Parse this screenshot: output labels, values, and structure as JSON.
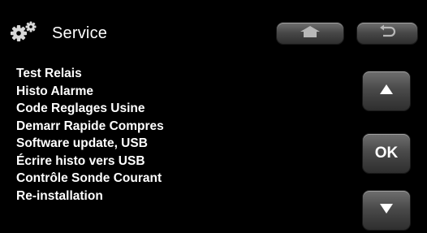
{
  "header": {
    "title": "Service",
    "icon": "gears-icon",
    "buttons": [
      {
        "name": "home-button",
        "icon": "home-icon"
      },
      {
        "name": "back-button",
        "icon": "back-arrow-icon"
      }
    ]
  },
  "menu": {
    "items": [
      {
        "label": "Test Relais"
      },
      {
        "label": "Histo Alarme"
      },
      {
        "label": "Code Reglages Usine"
      },
      {
        "label": "Demarr Rapide Compres"
      },
      {
        "label": "Software update, USB"
      },
      {
        "label": "Écrire histo vers USB"
      },
      {
        "label": "Contrôle Sonde Courant"
      },
      {
        "label": "Re-installation"
      }
    ]
  },
  "nav": {
    "up_icon": "triangle-up-icon",
    "ok_label": "OK",
    "down_icon": "triangle-down-icon"
  },
  "colors": {
    "background": "#000000",
    "text": "#ffffff",
    "button_top": "#6f6f6f",
    "button_bottom": "#2e2e2e"
  }
}
